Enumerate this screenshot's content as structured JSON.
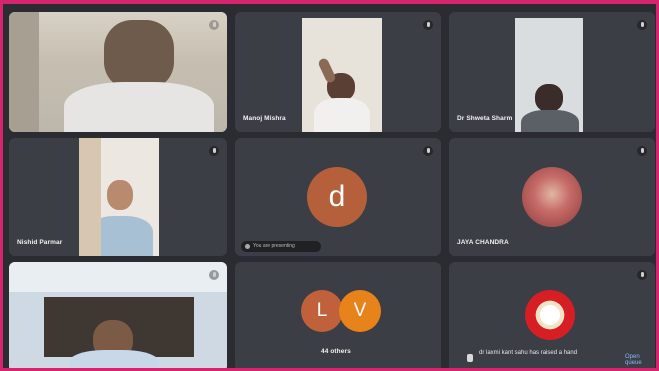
{
  "participants": [
    {
      "name": ""
    },
    {
      "name": "Manoj Mishra"
    },
    {
      "name": "Dr Shweta Sharm"
    },
    {
      "name": "Nishid Parmar"
    },
    {
      "name": "",
      "initial": "d",
      "pill_text": "You are presenting"
    },
    {
      "name": "JAYA CHANDRA"
    },
    {
      "name": ""
    },
    {
      "name": "44 others",
      "initials": [
        "L",
        "V"
      ]
    },
    {
      "name": ""
    }
  ],
  "notification": {
    "text": "dr laxmi kant sahu has raised a hand",
    "action_label": "Open queue"
  },
  "icons": [
    "mic-off-icon",
    "hand-raised-icon"
  ],
  "colors": {
    "frame": "#d6246e",
    "avatar_d": "#b5603a",
    "avatar_L": "#c0613b",
    "avatar_V": "#e8821a",
    "link": "#8ab4f8"
  }
}
